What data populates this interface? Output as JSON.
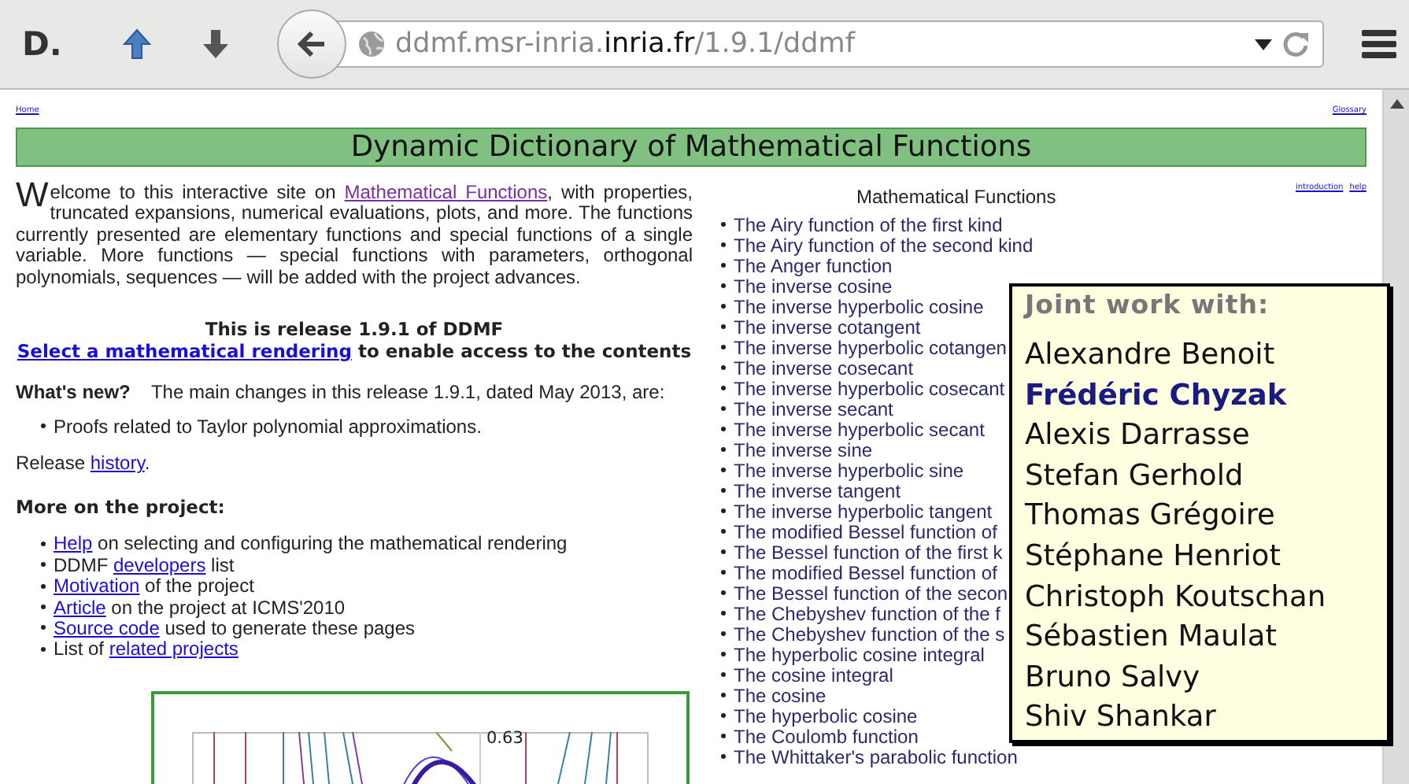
{
  "toolbar": {
    "logo": "D.",
    "url": {
      "prefix": "ddmf.msr-inria.",
      "domain": "inria.fr",
      "path": "/1.9.1/ddmf"
    }
  },
  "page": {
    "top_links": [
      "Home",
      "Glossary"
    ],
    "title": "Dynamic Dictionary of Mathematical Functions",
    "intro": {
      "lead": "W",
      "before": "elcome to this interactive site on ",
      "link": "Mathematical Functions",
      "visited": true,
      "after": ", with properties, truncated expansions, numerical evaluations, plots, and more. The functions currently presented are elementary functions and special functions of a single variable. More functions — special functions with parameters, orthogonal polynomials, sequences — will be added with the project advances."
    },
    "release": {
      "title": "This is release 1.9.1 of DDMF",
      "link": "Select a mathematical rendering",
      "after": " to enable access to the contents"
    },
    "whats_new": {
      "label": "What's new?",
      "text": "The main changes in this release 1.9.1, dated May 2013, are:",
      "items": [
        "Proofs related to Taylor polynomial approximations."
      ]
    },
    "history": {
      "before": "Release ",
      "link": "history",
      "after": "."
    },
    "more": {
      "heading": "More on the project:",
      "items": [
        {
          "link": "Help",
          "after": " on selecting and configuring the mathematical rendering"
        },
        {
          "before": "DDMF ",
          "link": "developers",
          "after": " list"
        },
        {
          "link": "Motivation",
          "after": " of the project"
        },
        {
          "link": "Article",
          "after": " on the project at ICMS'2010"
        },
        {
          "link": "Source code",
          "after": " used to generate these pages"
        },
        {
          "before": "List of ",
          "link": "related projects"
        }
      ]
    },
    "plot": {
      "label": "0.63"
    },
    "functions": {
      "heading": "Mathematical Functions",
      "links": [
        "introduction",
        "help"
      ],
      "items": [
        "The Airy function of the first kind",
        "The Airy function of the second kind",
        "The Anger function",
        "The inverse cosine",
        "The inverse hyperbolic cosine",
        "The inverse cotangent",
        "The inverse hyperbolic cotangen",
        "The inverse cosecant",
        "The inverse hyperbolic cosecant",
        "The inverse secant",
        "The inverse hyperbolic secant",
        "The inverse sine",
        "The inverse hyperbolic sine",
        "The inverse tangent",
        "The inverse hyperbolic tangent",
        "The modified Bessel function of",
        "The Bessel function of the first k",
        "The modified Bessel function of",
        "The Bessel function of the secon",
        "The Chebyshev function of the f",
        "The Chebyshev function of the s",
        "The hyperbolic cosine integral",
        "The cosine integral",
        "The cosine",
        "The hyperbolic cosine",
        "The Coulomb function",
        "The Whittaker's parabolic function"
      ]
    }
  },
  "overlay": {
    "heading": "Joint work with:",
    "names": [
      {
        "name": "Alexandre Benoit",
        "highlighted": false
      },
      {
        "name": "Frédéric Chyzak",
        "highlighted": true
      },
      {
        "name": "Alexis Darrasse",
        "highlighted": false
      },
      {
        "name": "Stefan Gerhold",
        "highlighted": false
      },
      {
        "name": "Thomas Grégoire",
        "highlighted": false
      },
      {
        "name": "Stéphane Henriot",
        "highlighted": false
      },
      {
        "name": "Christoph Koutschan",
        "highlighted": false
      },
      {
        "name": "Sébastien Maulat",
        "highlighted": false
      },
      {
        "name": "Bruno Salvy",
        "highlighted": false
      },
      {
        "name": "Shiv Shankar",
        "highlighted": false
      }
    ]
  }
}
